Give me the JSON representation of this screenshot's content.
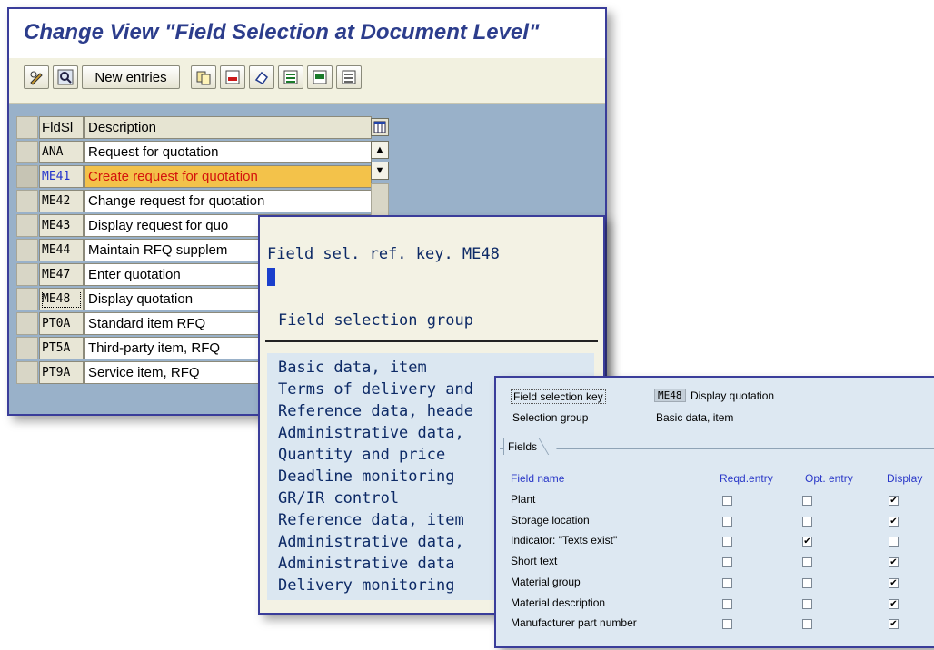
{
  "window1": {
    "title": "Change View \"Field Selection at Document Level\"",
    "toolbar": {
      "new_entries": "New entries"
    },
    "table": {
      "columns": [
        "FldSl",
        "Description"
      ],
      "rows": [
        {
          "key": "ANA",
          "desc": "Request for quotation"
        },
        {
          "key": "ME41",
          "desc": "Create request for quotation"
        },
        {
          "key": "ME42",
          "desc": "Change request for quotation"
        },
        {
          "key": "ME43",
          "desc": "Display request for quo"
        },
        {
          "key": "ME44",
          "desc": "Maintain RFQ supplem"
        },
        {
          "key": "ME47",
          "desc": "Enter quotation"
        },
        {
          "key": "ME48",
          "desc": "Display quotation"
        },
        {
          "key": "PT0A",
          "desc": "Standard item RFQ"
        },
        {
          "key": "PT5A",
          "desc": "Third-party item, RFQ"
        },
        {
          "key": "PT9A",
          "desc": "Service item, RFQ"
        }
      ]
    }
  },
  "window2": {
    "ref_key_label": "Field sel. ref. key. ME48",
    "group_header": "Field selection group",
    "groups": [
      "Basic data, item",
      "Terms of delivery and",
      "Reference data, heade",
      "Administrative data,",
      "Quantity and price",
      "Deadline monitoring",
      "GR/IR control",
      "Reference data, item",
      "Administrative data,",
      "Administrative data",
      "Delivery monitoring"
    ]
  },
  "window3": {
    "field_selection_key_label": "Field selection key",
    "field_selection_key_value": "ME48",
    "field_selection_key_desc": "Display quotation",
    "selection_group_label": "Selection group",
    "selection_group_value": "Basic data, item",
    "fields_tab": "Fields",
    "columns": {
      "name": "Field name",
      "reqd": "Reqd.entry",
      "opt": "Opt. entry",
      "display": "Display"
    },
    "fields": [
      {
        "name": "Plant",
        "reqd": false,
        "opt": false,
        "display": true
      },
      {
        "name": "Storage location",
        "reqd": false,
        "opt": false,
        "display": true
      },
      {
        "name": "Indicator: \"Texts exist\"",
        "reqd": false,
        "opt": true,
        "display": false
      },
      {
        "name": "Short text",
        "reqd": false,
        "opt": false,
        "display": true
      },
      {
        "name": "Material group",
        "reqd": false,
        "opt": false,
        "display": true
      },
      {
        "name": "Material description",
        "reqd": false,
        "opt": false,
        "display": true
      },
      {
        "name": "Manufacturer part number",
        "reqd": false,
        "opt": false,
        "display": true
      }
    ]
  }
}
